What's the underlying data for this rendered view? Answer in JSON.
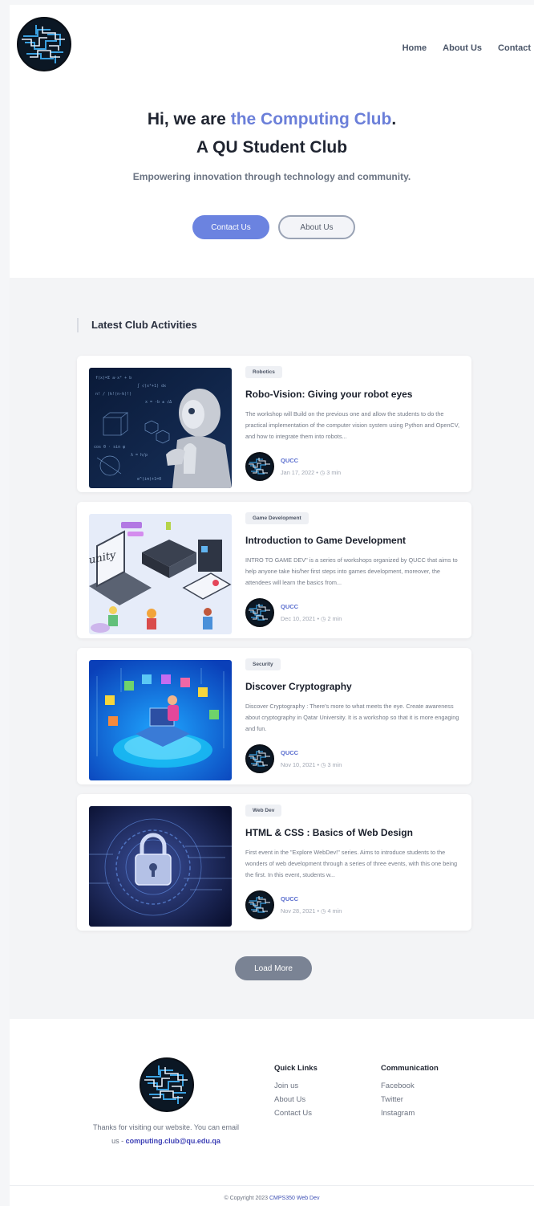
{
  "nav": {
    "home": "Home",
    "about": "About Us",
    "contact": "Contact"
  },
  "hero": {
    "title_prefix": "Hi, we are ",
    "title_accent": "the Computing  Club",
    "title_suffix": ".",
    "title_line2": "A QU Student Club",
    "subtitle": "Empowering innovation through technology and community.",
    "contact_button": "Contact Us",
    "about_button": "About Us"
  },
  "activities": {
    "section_title": "Latest Club Activities",
    "cards": [
      {
        "tag": "Robotics",
        "title": "Robo-Vision: Giving your robot eyes",
        "desc": "The workshop will Build on the previous one and allow the students to do the practical implementation of the computer vision system using Python and OpenCV, and how to integrate them into robots...",
        "author": "QUCC",
        "date": "Jan 17, 2022",
        "read": "3 min"
      },
      {
        "tag": "Game Development",
        "title": "Introduction to Game Development",
        "desc": "INTRO TO GAME DEV\" is a series of workshops organized by QUCC that aims to help anyone take his/her first steps into games development, moreover, the attendees will learn the basics from...",
        "author": "QUCC",
        "date": "Dec 10, 2021",
        "read": "2 min"
      },
      {
        "tag": "Security",
        "title": "Discover Cryptography",
        "desc": "Discover Cryptography : There's more to what meets the eye. Create awareness about cryptography in Qatar University. It is a workshop so that it is more engaging and fun.",
        "author": "QUCC",
        "date": "Nov 10, 2021",
        "read": "3 min"
      },
      {
        "tag": "Web Dev",
        "title": "HTML & CSS : Basics of Web Design",
        "desc": "First event in the \"Explore WebDev!\" series. Aims to introduce students to the wonders of web development through a series of three events, with this one being the first. In this event, students w...",
        "author": "QUCC",
        "date": "Nov 28, 2021",
        "read": "4 min"
      }
    ],
    "load_more": "Load More"
  },
  "footer": {
    "desc": "Thanks for visiting our website. You can email us - ",
    "email": "computing.club@qu.edu.qa",
    "quick_links_title": "Quick Links",
    "quick_links": [
      "Join us",
      "About Us",
      "Contact Us"
    ],
    "communication_title": "Communication",
    "communication": [
      "Facebook",
      "Twitter",
      "Instagram"
    ],
    "copyright_prefix": "© Copyright 2023 ",
    "copyright_link": "CMPS350 Web Dev"
  },
  "icons": {
    "logo": "circuit-maze-logo",
    "clock": "clock-icon",
    "dot": "separator-dot"
  },
  "colors": {
    "accent": "#6b7fd9",
    "primary_button": "#6b83e0",
    "load_more": "#7a8394",
    "author": "#5b6fcf",
    "email": "#3c3fb5"
  }
}
